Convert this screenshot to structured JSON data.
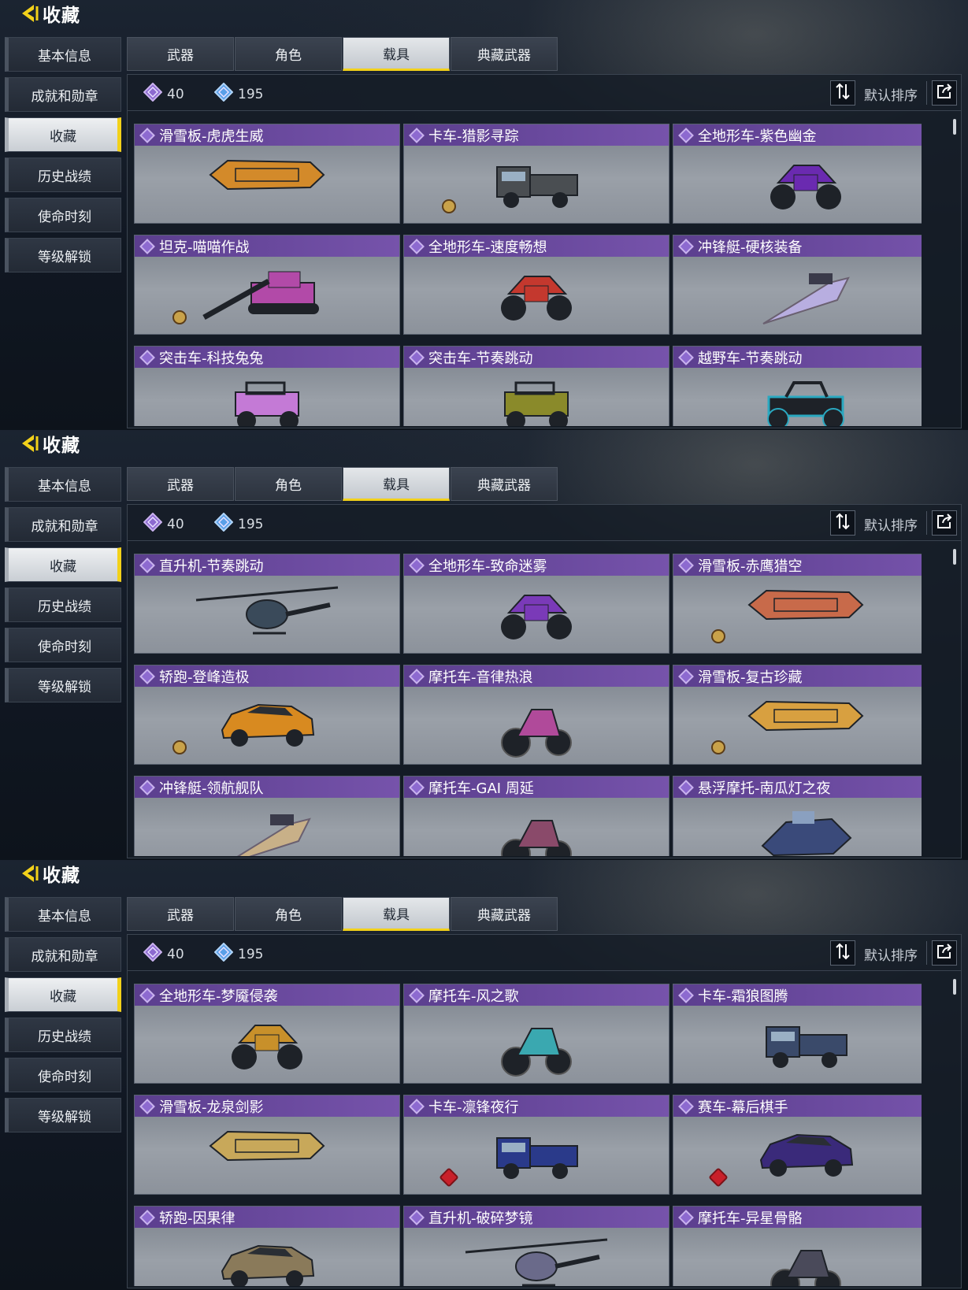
{
  "title": "收藏",
  "sidenav": [
    "基本信息",
    "成就和勋章",
    "收藏",
    "历史战绩",
    "使命时刻",
    "等级解锁"
  ],
  "active_nav": 2,
  "tabs": [
    "武器",
    "角色",
    "载具",
    "典藏武器"
  ],
  "active_tab": 2,
  "currency": {
    "purple": "40",
    "blue": "195"
  },
  "sort_label": "默认排序",
  "colors": {
    "accent": "#f2d11a",
    "card_header": "#6a4a9e",
    "rarity": "#8d6ad0",
    "blue_currency": "#5aa0e8"
  },
  "panels": [
    {
      "items": [
        {
          "name": "滑雪板-虎虎生威",
          "veh": "board",
          "color": "#d38a2a"
        },
        {
          "name": "卡车-猎影寻踪",
          "veh": "truck",
          "color": "#4a4e52",
          "badge": "gold"
        },
        {
          "name": "全地形车-紫色幽金",
          "veh": "atv",
          "color": "#6a2ab0"
        },
        {
          "name": "坦克-喵喵作战",
          "veh": "tank",
          "color": "#b24aa8",
          "badge": "gold"
        },
        {
          "name": "全地形车-速度畅想",
          "veh": "atv",
          "color": "#c4382e"
        },
        {
          "name": "冲锋艇-硬核装备",
          "veh": "boat",
          "color": "#b8aee0"
        },
        {
          "name": "突击车-科技兔兔",
          "veh": "jeep",
          "color": "#c47ad6"
        },
        {
          "name": "突击车-节奏跳动",
          "veh": "jeep",
          "color": "#8a8a2a"
        },
        {
          "name": "越野车-节奏跳动",
          "veh": "buggy",
          "color": "#2aa8c0"
        }
      ]
    },
    {
      "items": [
        {
          "name": "直升机-节奏跳动",
          "veh": "heli",
          "color": "#3a4a5a"
        },
        {
          "name": "全地形车-致命迷雾",
          "veh": "atv",
          "color": "#7a3ab8"
        },
        {
          "name": "滑雪板-赤鹰猎空",
          "veh": "board",
          "color": "#c86a4a",
          "badge": "gold"
        },
        {
          "name": "轿跑-登峰造极",
          "veh": "car",
          "color": "#d88a20",
          "badge": "gold"
        },
        {
          "name": "摩托车-音律热浪",
          "veh": "moto",
          "color": "#b04a9a"
        },
        {
          "name": "滑雪板-复古珍藏",
          "veh": "board",
          "color": "#d8a040",
          "badge": "gold"
        },
        {
          "name": "冲锋艇-领航舰队",
          "veh": "boat",
          "color": "#c8b088"
        },
        {
          "name": "摩托车-GAI 周延",
          "veh": "moto",
          "color": "#8a4a6a"
        },
        {
          "name": "悬浮摩托-南瓜灯之夜",
          "veh": "hover",
          "color": "#3a4a7a"
        }
      ]
    },
    {
      "slice": true,
      "items": [
        {
          "name": "全地形车-梦魇侵袭",
          "veh": "atv",
          "color": "#c8902a"
        },
        {
          "name": "摩托车-风之歌",
          "veh": "moto",
          "color": "#3aa8b0"
        },
        {
          "name": "卡车-霜狼图腾",
          "veh": "truck",
          "color": "#3a4a6a"
        },
        {
          "name": "滑雪板-龙泉剑影",
          "veh": "board",
          "color": "#c8a85a"
        },
        {
          "name": "卡车-凛锋夜行",
          "veh": "truck",
          "color": "#2a3a8a",
          "badge": "red"
        },
        {
          "name": "赛车-幕后棋手",
          "veh": "car",
          "color": "#3a2a7a",
          "badge": "red"
        },
        {
          "name": "轿跑-因果律",
          "veh": "car",
          "color": "#8a7a5a"
        },
        {
          "name": "直升机-破碎梦镜",
          "veh": "heli",
          "color": "#6a6a8a"
        },
        {
          "name": "摩托车-异星骨骼",
          "veh": "moto",
          "color": "#4a4a5a"
        }
      ]
    }
  ]
}
